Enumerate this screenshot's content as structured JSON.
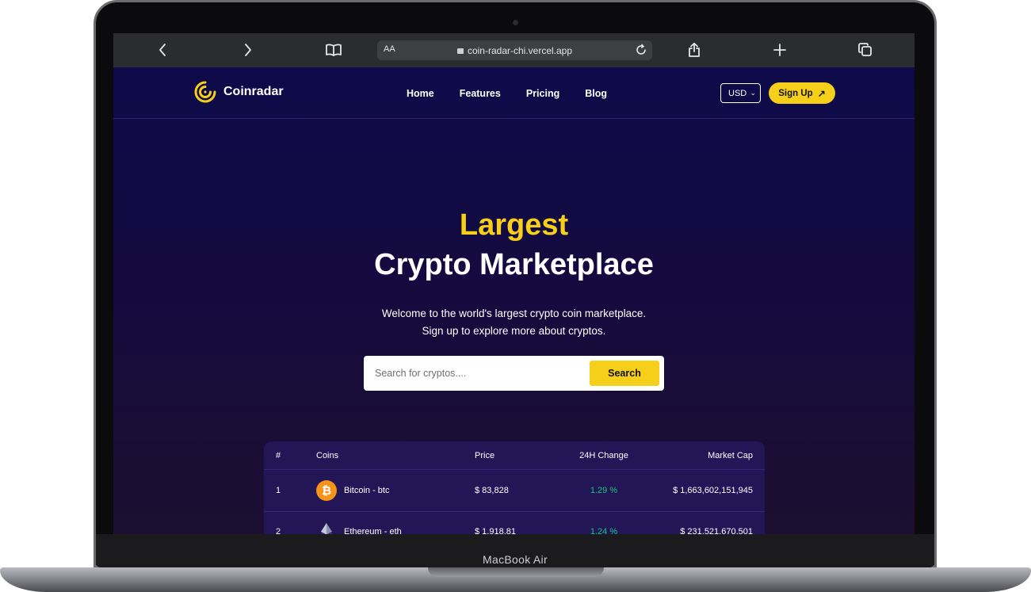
{
  "device": {
    "label": "MacBook Air"
  },
  "browser": {
    "url": "coin-radar-chi.vercel.app",
    "text_size_label": "AA"
  },
  "site": {
    "brand": "Coinradar",
    "nav": [
      "Home",
      "Features",
      "Pricing",
      "Blog"
    ],
    "currency": "USD",
    "signup_label": "Sign Up",
    "hero": {
      "title_line1": "Largest",
      "title_line2": "Crypto Marketplace",
      "subtitle_line1": "Welcome to the world's largest crypto coin marketplace.",
      "subtitle_line2": "Sign up to explore more about cryptos."
    },
    "search": {
      "placeholder": "Search for cryptos....",
      "button_label": "Search"
    },
    "table": {
      "headers": [
        "#",
        "Coins",
        "Price",
        "24H Change",
        "Market Cap"
      ],
      "rows": [
        {
          "rank": "1",
          "coin": "Bitcoin - btc",
          "icon": "bitcoin-icon",
          "price": "$ 83,828",
          "change": "1.29 %",
          "market_cap": "$ 1,663,602,151,945"
        },
        {
          "rank": "2",
          "coin": "Ethereum - eth",
          "icon": "ethereum-icon",
          "price": "$ 1,918.81",
          "change": "1.24 %",
          "market_cap": "$ 231,521,670,501"
        }
      ]
    }
  },
  "colors": {
    "accent": "#f5cf19",
    "background": "#0e0a4a",
    "positive": "#16c784",
    "table_bg": "#231656"
  }
}
